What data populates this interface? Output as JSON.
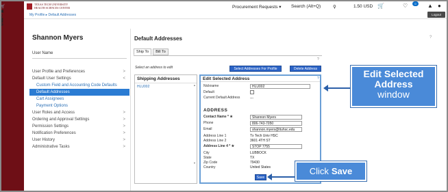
{
  "header": {
    "logo_text_1": "TEXAS TECH UNIVERSITY",
    "logo_text_2": "HEALTH SCIENCES CENTER",
    "breadcrumb": "My Profile ▸ Default Addresses",
    "procurement": "Procurement Requests ▾",
    "search": "Search (Alt+Q)",
    "currency": "1.50 USD",
    "notif_count": "0",
    "logout": "Logout"
  },
  "left_nav": {
    "icons": [
      "home-icon",
      "cart-icon",
      "documents-icon",
      "money-icon",
      "bank-icon",
      "analytics-icon"
    ]
  },
  "profile": {
    "name": "Shannon Myers",
    "username_label": "User Name",
    "menu": [
      {
        "label": "User Profile and Preferences",
        "chev": ">",
        "type": "top"
      },
      {
        "label": "Default User Settings",
        "chev": "v",
        "type": "top"
      },
      {
        "label": "Custom Field and Accounting Code Defaults",
        "chev": "",
        "type": "sub"
      },
      {
        "label": "Default Addresses",
        "chev": "",
        "type": "selected"
      },
      {
        "label": "Cart Assignees",
        "chev": "",
        "type": "sub"
      },
      {
        "label": "Payment Options",
        "chev": "",
        "type": "sub"
      },
      {
        "label": "User Roles and Access",
        "chev": ">",
        "type": "top"
      },
      {
        "label": "Ordering and Approval Settings",
        "chev": ">",
        "type": "top"
      },
      {
        "label": "Permission Settings",
        "chev": ">",
        "type": "top"
      },
      {
        "label": "Notification Preferences",
        "chev": ">",
        "type": "top"
      },
      {
        "label": "User History",
        "chev": ">",
        "type": "top"
      },
      {
        "label": "Administrative Tasks",
        "chev": ">",
        "type": "top"
      }
    ]
  },
  "main": {
    "title": "Default Addresses",
    "help": "?",
    "tabs": [
      "Ship To",
      "Bill To"
    ],
    "select_hint": "Select an address to edit",
    "btn_select_profile": "Select Addresses For Profile",
    "btn_delete": "Delete Address",
    "shipping_header": "Shipping Addresses",
    "shipping_items": [
      "HLU002"
    ],
    "edit": {
      "header": "Edit Selected Address",
      "nickname_label": "Nickname",
      "nickname_value": "HLU002",
      "default_label": "Default",
      "current_default_label": "Current Default Address",
      "current_default_value": "---",
      "address_header": "ADDRESS",
      "fields": [
        {
          "label": "Contact Name * ★",
          "value": "Shannon Myers",
          "input": true,
          "bold": true
        },
        {
          "label": "Phone",
          "value": "806-743-7050",
          "input": true,
          "bold": false
        },
        {
          "label": "Email",
          "value": "shannon.myers@ttuhsc.edu",
          "input": true,
          "bold": false
        },
        {
          "label": "Address Line 1",
          "value": "Tx Tech Univ HSC",
          "input": false,
          "bold": false
        },
        {
          "label": "Address Line 2",
          "value": "3601 4TH ST",
          "input": false,
          "bold": false
        },
        {
          "label": "Address Line 4 * ★",
          "value": "STOP 7755",
          "input": true,
          "bold": true
        },
        {
          "label": "City",
          "value": "LUBBOCK",
          "input": false,
          "bold": false
        },
        {
          "label": "State",
          "value": "TX",
          "input": false,
          "bold": false
        },
        {
          "label": "Zip Code",
          "value": "79430",
          "input": false,
          "bold": false
        },
        {
          "label": "Country",
          "value": "United States",
          "input": false,
          "bold": false
        }
      ],
      "save": "Save"
    }
  },
  "callouts": {
    "edit_line1": "Edit Selected",
    "edit_line2": "Address",
    "edit_line3": "window",
    "save_prefix": "Click",
    "save_word": "Save"
  },
  "colors": {
    "nav_red": "#6e0f16",
    "accent_blue": "#2b7cd3",
    "callout_blue": "#4a8ad8"
  }
}
